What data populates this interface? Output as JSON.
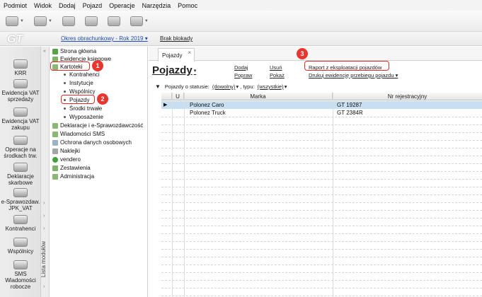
{
  "menu": [
    "Podmiot",
    "Widok",
    "Dodaj",
    "Pojazd",
    "Operacje",
    "Narzędzia",
    "Pomoc"
  ],
  "infobar": {
    "logo": "GT",
    "period": "Okres obrachunkowy - Rok 2019 ▾",
    "lock": "Brak blokady"
  },
  "leftbar": [
    {
      "label": "KRR",
      "icon": "printer-icon"
    },
    {
      "label": "Ewidencja VAT sprzedaży",
      "icon": "printer-icon"
    },
    {
      "label": "Ewidencja VAT zakupu",
      "icon": "printer-icon"
    },
    {
      "label": "Operacje na środkach trw.",
      "icon": "assets-icon"
    },
    {
      "label": "Deklaracje skarbowe",
      "icon": "declaration-icon"
    },
    {
      "label": "e-Sprawozdaw. JPK_VAT",
      "icon": "report-icon"
    },
    {
      "label": "Kontrahenci",
      "icon": "contractors-icon"
    },
    {
      "label": "Wspólnicy",
      "icon": "partners-icon"
    },
    {
      "label": "SMS Wiadomości robocze",
      "icon": "sms-icon"
    }
  ],
  "modules_label": "Lista modułów",
  "tree": {
    "items": [
      {
        "label": "Strona główna",
        "level": 0,
        "icon": "home-icon"
      },
      {
        "label": "Ewidencje księgowe",
        "level": 0,
        "icon": "ledger-icon"
      },
      {
        "label": "Kartoteki",
        "level": 0,
        "icon": "folder-icon"
      },
      {
        "label": "Kontrahenci",
        "level": 1
      },
      {
        "label": "Instytucje",
        "level": 1
      },
      {
        "label": "Wspólnicy",
        "level": 1
      },
      {
        "label": "Pojazdy",
        "level": 1
      },
      {
        "label": "Środki trwałe",
        "level": 1
      },
      {
        "label": "Wyposażenie",
        "level": 1
      },
      {
        "label": "Deklaracje i e-Sprawozdawczość",
        "level": 0,
        "icon": "declaration-icon"
      },
      {
        "label": "Wiadomości SMS",
        "level": 0,
        "icon": "sms-icon"
      },
      {
        "label": "Ochrona danych osobowych",
        "level": 0,
        "icon": "shield-icon"
      },
      {
        "label": "Naklejki",
        "level": 0,
        "icon": "sticker-icon"
      },
      {
        "label": "vendero",
        "level": 0,
        "icon": "vendero-icon"
      },
      {
        "label": "Zestawienia",
        "level": 0,
        "icon": "report-icon"
      },
      {
        "label": "Administracja",
        "level": 0,
        "icon": "admin-icon"
      }
    ]
  },
  "badges": [
    "1",
    "2",
    "3"
  ],
  "tab": {
    "label": "Pojazdy",
    "close": "×"
  },
  "page": {
    "title": "Pojazdy",
    "actions": {
      "add": "Dodaj",
      "remove": "Usuń",
      "edit": "Popraw",
      "show": "Pokaż",
      "report": "Raport z eksploatacji pojazdów",
      "print": "Drukuj ewidencję przebiegu pojazdu ▾"
    }
  },
  "filter": {
    "status_label": "Pojazdy o statusie:",
    "status_value": "(dowolny)",
    "type_label": ", typu:",
    "type_value": "(wszystkie)"
  },
  "grid": {
    "columns": [
      "",
      "U",
      "Marka",
      "Nr rejestracyjny"
    ],
    "rows": [
      {
        "marker": "▶",
        "marka": "Polonez Caro",
        "nr": "GT 19287"
      },
      {
        "marker": "",
        "marka": "Polonez Truck",
        "nr": "GT 2384R"
      }
    ]
  },
  "colors": {
    "highlight": "#e02a2a",
    "badge": "#e8362f",
    "link": "#1f4fb0",
    "selection": "#c8def1"
  }
}
